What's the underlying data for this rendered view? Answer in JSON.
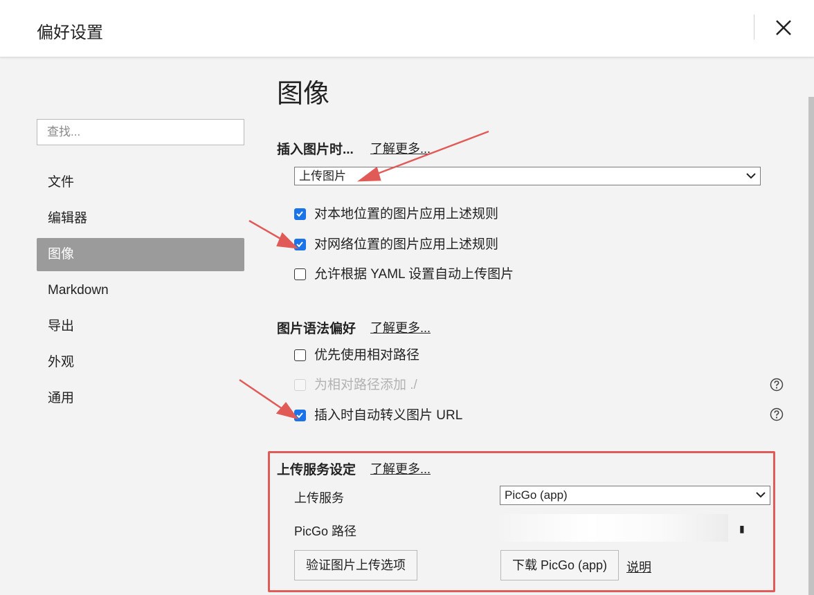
{
  "window": {
    "title": "偏好设置"
  },
  "sidebar": {
    "search_placeholder": "查找...",
    "items": [
      {
        "label": "文件"
      },
      {
        "label": "编辑器"
      },
      {
        "label": "图像",
        "active": true
      },
      {
        "label": "Markdown"
      },
      {
        "label": "导出"
      },
      {
        "label": "外观"
      },
      {
        "label": "通用"
      }
    ]
  },
  "main": {
    "title": "图像",
    "insert_section": {
      "title": "插入图片时...",
      "learn_more": "了解更多...",
      "select_value": "上传图片",
      "options": [
        {
          "label": "对本地位置的图片应用上述规则",
          "checked": true,
          "disabled": false
        },
        {
          "label": "对网络位置的图片应用上述规则",
          "checked": true,
          "disabled": false
        },
        {
          "label": "允许根据 YAML 设置自动上传图片",
          "checked": false,
          "disabled": false
        }
      ]
    },
    "syntax_section": {
      "title": "图片语法偏好",
      "learn_more": "了解更多...",
      "options": [
        {
          "label": "优先使用相对路径",
          "checked": false,
          "disabled": false
        },
        {
          "label": "为相对路径添加 ./",
          "checked": false,
          "disabled": true
        },
        {
          "label": "插入时自动转义图片 URL",
          "checked": true,
          "disabled": false
        }
      ]
    },
    "upload_section": {
      "title": "上传服务设定",
      "learn_more": "了解更多...",
      "service_label": "上传服务",
      "service_value": "PicGo (app)",
      "path_label": "PicGo 路径",
      "verify_button": "验证图片上传选项",
      "download_button": "下载 PicGo (app)",
      "help_link": "说明"
    }
  },
  "colors": {
    "accent": "#1a73e8",
    "annotation": "#e05a58",
    "sidebar_active_bg": "#9b9b9b"
  }
}
